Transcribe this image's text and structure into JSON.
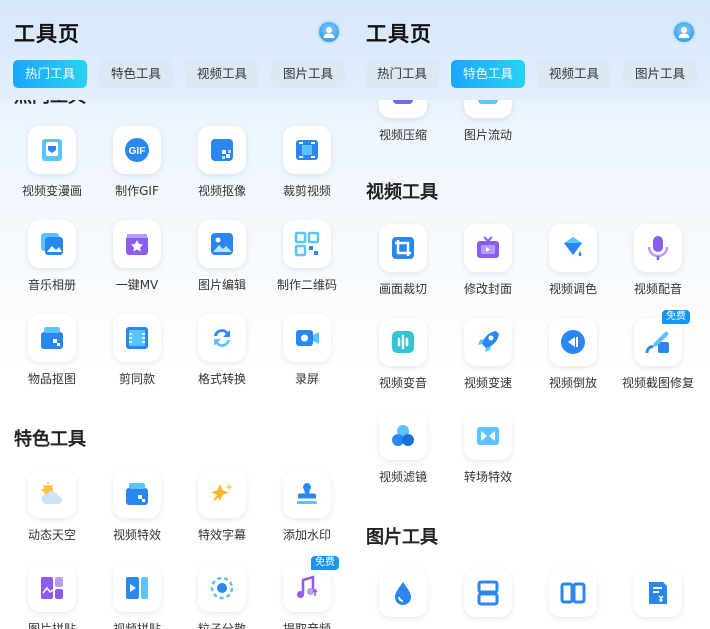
{
  "left": {
    "title": "工具页",
    "tabs": [
      "热门工具",
      "特色工具",
      "视频工具",
      "图片工具"
    ],
    "peek_heading": "热门工具",
    "hot_tools": [
      {
        "label": "视频变漫画",
        "icon": "portrait-card-icon"
      },
      {
        "label": "制作GIF",
        "icon": "gif-icon"
      },
      {
        "label": "视频抠像",
        "icon": "matting-icon"
      },
      {
        "label": "裁剪视频",
        "icon": "crop-frame-icon"
      },
      {
        "label": "音乐相册",
        "icon": "music-album-icon"
      },
      {
        "label": "一键MV",
        "icon": "star-clapper-icon"
      },
      {
        "label": "图片编辑",
        "icon": "image-edit-icon"
      },
      {
        "label": "制作二维码",
        "icon": "qr-code-icon"
      },
      {
        "label": "物品抠图",
        "icon": "object-cutout-icon"
      },
      {
        "label": "剪同款",
        "icon": "film-template-icon"
      },
      {
        "label": "格式转换",
        "icon": "convert-icon"
      },
      {
        "label": "录屏",
        "icon": "screen-record-icon"
      }
    ],
    "featured_heading": "特色工具",
    "featured_tools": [
      {
        "label": "动态天空",
        "icon": "sky-icon"
      },
      {
        "label": "视频特效",
        "icon": "video-effect-icon"
      },
      {
        "label": "特效字幕",
        "icon": "sparkle-icon"
      },
      {
        "label": "添加水印",
        "icon": "stamp-icon"
      },
      {
        "label": "图片拼贴",
        "icon": "collage-icon"
      },
      {
        "label": "视频拼贴",
        "icon": "video-collage-icon"
      },
      {
        "label": "粒子分散",
        "icon": "particle-icon"
      },
      {
        "label": "提取音频",
        "icon": "extract-audio-icon",
        "badge": "免费"
      }
    ]
  },
  "right": {
    "title": "工具页",
    "tabs": [
      "热门工具",
      "特色工具",
      "视频工具",
      "图片工具"
    ],
    "peek_tools": [
      {
        "label": "视频压缩",
        "icon": "compress-icon"
      },
      {
        "label": "图片流动",
        "icon": "image-flow-icon"
      }
    ],
    "video_heading": "视频工具",
    "video_tools": [
      {
        "label": "画面裁切",
        "icon": "crop-icon"
      },
      {
        "label": "修改封面",
        "icon": "tv-cover-icon"
      },
      {
        "label": "视频调色",
        "icon": "paint-bucket-icon"
      },
      {
        "label": "视频配音",
        "icon": "microphone-icon"
      },
      {
        "label": "视频变音",
        "icon": "voice-change-icon"
      },
      {
        "label": "视频变速",
        "icon": "rocket-icon"
      },
      {
        "label": "视频倒放",
        "icon": "rewind-icon"
      },
      {
        "label": "视频截图修复",
        "icon": "repair-brush-icon",
        "badge": "免费"
      },
      {
        "label": "视频滤镜",
        "icon": "filter-icon"
      },
      {
        "label": "转场特效",
        "icon": "transition-icon"
      }
    ],
    "image_heading": "图片工具",
    "image_tools": [
      {
        "label": "",
        "icon": "water-drop-icon"
      },
      {
        "label": "",
        "icon": "vertical-split-icon"
      },
      {
        "label": "",
        "icon": "horizontal-split-icon"
      },
      {
        "label": "",
        "icon": "document-yen-icon"
      }
    ]
  },
  "colors": {
    "accent": "#1596f5",
    "tab_active_start": "#19a6ff",
    "tab_active_end": "#2ad2f0"
  }
}
